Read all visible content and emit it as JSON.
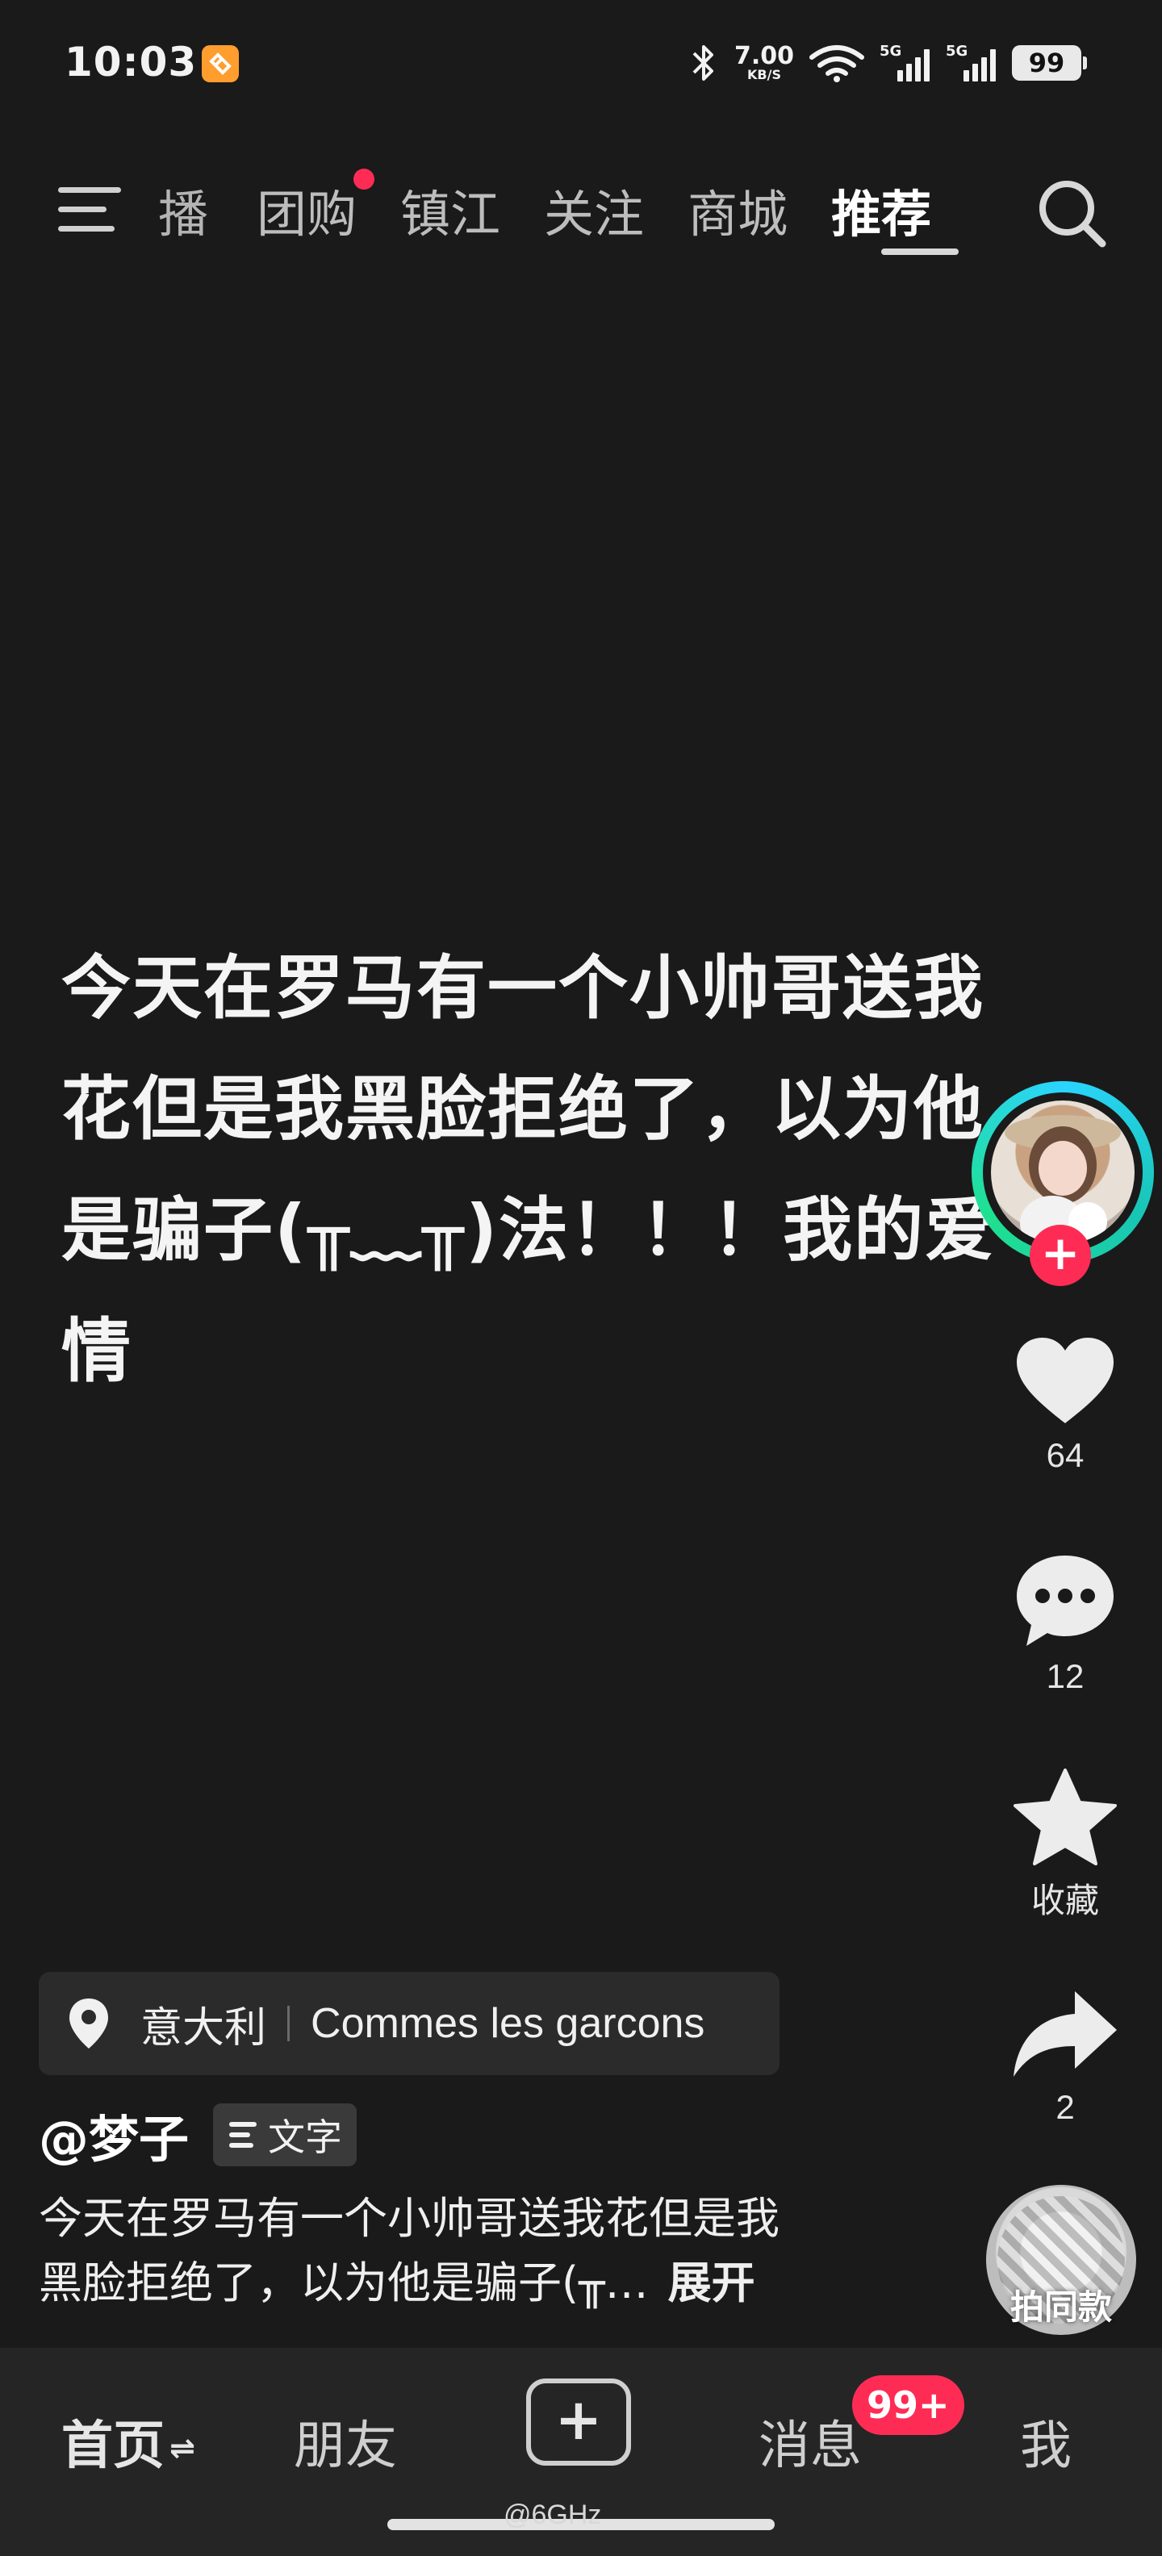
{
  "status_bar": {
    "time": "10:03",
    "net_speed_value": "7.00",
    "net_speed_unit": "KB/S",
    "signal_1_tag": "5G",
    "signal_2_tag": "5G",
    "battery": "99"
  },
  "top_nav": {
    "tabs": [
      {
        "label": "播",
        "partial": true
      },
      {
        "label": "团购",
        "has_dot": true
      },
      {
        "label": "镇江"
      },
      {
        "label": "关注"
      },
      {
        "label": "商城"
      },
      {
        "label": "推荐",
        "active": true
      }
    ]
  },
  "post": {
    "main_text": "今天在罗马有一个小帅哥送我\n花但是我黑脸拒绝了，以为他\n是骗子(╥﹏╥)法！！！我的爱\n情",
    "location": "意大利",
    "place": "Commes les garcons",
    "author": "@梦子",
    "tag_label": "文字",
    "desc_line_1": "今天在罗马有一个小帅哥送我花但是我",
    "desc_line_2": "黑脸拒绝了，以为他是骗子(╥…",
    "expand_label": "展开"
  },
  "actions": {
    "follow_label": "+",
    "like_count": "64",
    "comment_count": "12",
    "favorite_label": "收藏",
    "share_count": "2",
    "remix_label": "拍同款"
  },
  "bottom_nav": {
    "home": "首页",
    "home_switch": "⇌",
    "friends": "朋友",
    "create_label": "+",
    "messages": "消息",
    "messages_badge": "99+",
    "me": "我"
  },
  "watermark": "@6GHz",
  "colors": {
    "accent": "#fe2c55",
    "background": "#1a1a1a",
    "app_icon": "#ff9d2e",
    "avatar_ring": "#18c6b4"
  },
  "icons": {
    "menu": "hamburger-icon",
    "search": "search-icon",
    "like": "heart-icon",
    "comment": "comment-bubble-icon",
    "favorite": "star-icon",
    "share": "share-arrow-icon",
    "location": "pin-icon",
    "text_tag": "text-lines-icon"
  }
}
